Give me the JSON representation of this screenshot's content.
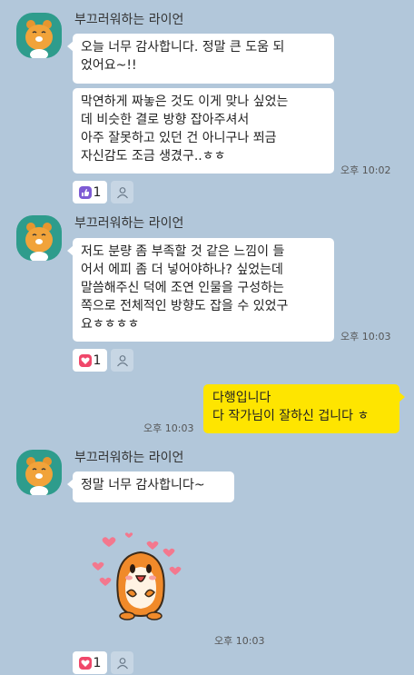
{
  "messages": [
    {
      "sender": "부끄러워하는 라이언",
      "bubbles": [
        "오늘 너무 감사합니다. 정말 큰 도움 되\n었어요~!!",
        "막연하게 짜놓은 것도 이게 맞나 싶었는\n데 비슷한 결로 방향 잡아주셔서\n아주 잘못하고 있던 건 아니구나 쬐금\n자신감도 조금 생겼구..ㅎㅎ"
      ],
      "time": "오후 10:02",
      "reaction": {
        "type": "thumbs-up",
        "count": "1",
        "color": "#7e5bd4"
      }
    },
    {
      "sender": "부끄러워하는 라이언",
      "bubbles": [
        "저도 분량 좀 부족할 것 같은 느낌이 들\n어서 에피 좀 더 넣어야하나? 싶었는데\n말씀해주신 덕에 조연 인물을 구성하는\n쪽으로 전체적인 방향도 잡을 수 있었구\n요ㅎㅎㅎㅎ"
      ],
      "time": "오후 10:03",
      "reaction": {
        "type": "heart",
        "count": "1",
        "color": "#f0476a"
      }
    },
    {
      "sender": "me",
      "bubbles": [
        "다행입니다\n다 작가님이 잘하신 겁니다 ㅎ"
      ],
      "time": "오후 10:03"
    },
    {
      "sender": "부끄러워하는 라이언",
      "bubbles": [
        "정말 너무 감사합니다~"
      ],
      "sticker": "hamster-with-hearts",
      "time": "오후 10:03",
      "reaction": {
        "type": "heart",
        "count": "1",
        "color": "#f0476a"
      }
    }
  ],
  "colors": {
    "background": "#b2c7da",
    "my_bubble": "#fee500",
    "their_bubble": "#ffffff"
  }
}
